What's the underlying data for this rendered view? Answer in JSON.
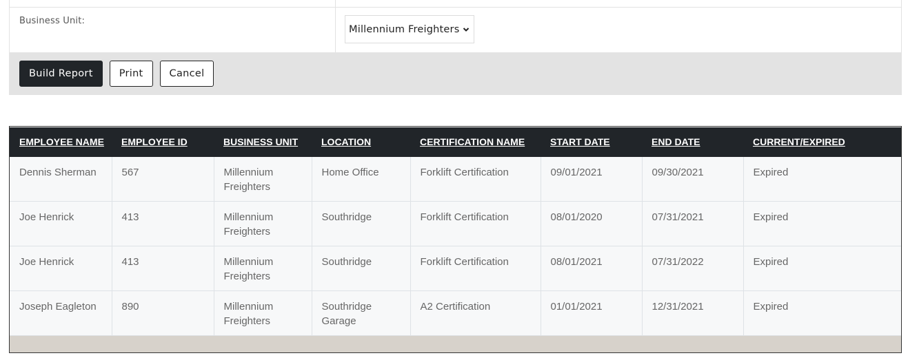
{
  "form": {
    "business_unit_label": "Business Unit:",
    "business_unit_value": "Millennium Freighters"
  },
  "buttons": {
    "build_report": "Build Report",
    "print": "Print",
    "cancel": "Cancel"
  },
  "colors": {
    "header_bg": "#212529",
    "button_bar_bg": "#e3e3e3",
    "row_bg": "#f7f8f9",
    "footer_bg": "#d7d2cb"
  },
  "report": {
    "columns": [
      "EMPLOYEE NAME",
      "EMPLOYEE ID",
      "BUSINESS UNIT",
      "LOCATION",
      "CERTIFICATION NAME",
      "START DATE",
      "END DATE",
      "CURRENT/EXPIRED"
    ],
    "rows": [
      [
        "Dennis Sherman",
        "567",
        "Millennium Freighters",
        "Home Office",
        "Forklift Certification",
        "09/01/2021",
        "09/30/2021",
        "Expired"
      ],
      [
        "Joe Henrick",
        "413",
        "Millennium Freighters",
        "Southridge",
        "Forklift Certification",
        "08/01/2020",
        "07/31/2021",
        "Expired"
      ],
      [
        "Joe Henrick",
        "413",
        "Millennium Freighters",
        "Southridge",
        "Forklift Certification",
        "08/01/2021",
        "07/31/2022",
        "Expired"
      ],
      [
        "Joseph Eagleton",
        "890",
        "Millennium Freighters",
        "Southridge Garage",
        "A2 Certification",
        "01/01/2021",
        "12/31/2021",
        "Expired"
      ]
    ]
  }
}
